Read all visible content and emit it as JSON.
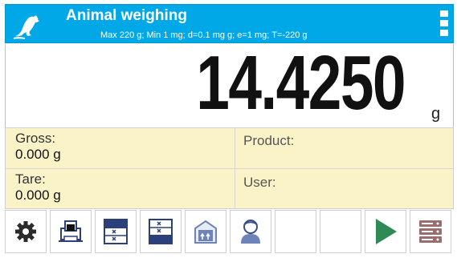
{
  "header": {
    "title": "Animal weighing",
    "subtitle": "Max 220 g; Min 1 mg; d=0.1 mg g; e=1 mg; T=-220 g",
    "mode_icon": "rat-icon",
    "menu_icon": "kebab-menu-icon",
    "background_color": "#00a8e8"
  },
  "display": {
    "reading": "14.4250",
    "unit": "g"
  },
  "info": {
    "gross_label": "Gross:",
    "gross_value": "0.000 g",
    "tare_label": "Tare:",
    "tare_value": "0.000 g",
    "product_label": "Product:",
    "user_label": "User:",
    "background_color": "#fbf3c8"
  },
  "toolbar": {
    "buttons": [
      {
        "icon": "gear-icon"
      },
      {
        "icon": "print-icon"
      },
      {
        "icon": "set-min-threshold-icon"
      },
      {
        "icon": "set-max-threshold-icon"
      },
      {
        "icon": "tare-package-icon"
      },
      {
        "icon": "user-icon"
      },
      {
        "icon": "empty"
      },
      {
        "icon": "empty"
      },
      {
        "icon": "start-play-icon"
      },
      {
        "icon": "database-icon"
      }
    ]
  }
}
